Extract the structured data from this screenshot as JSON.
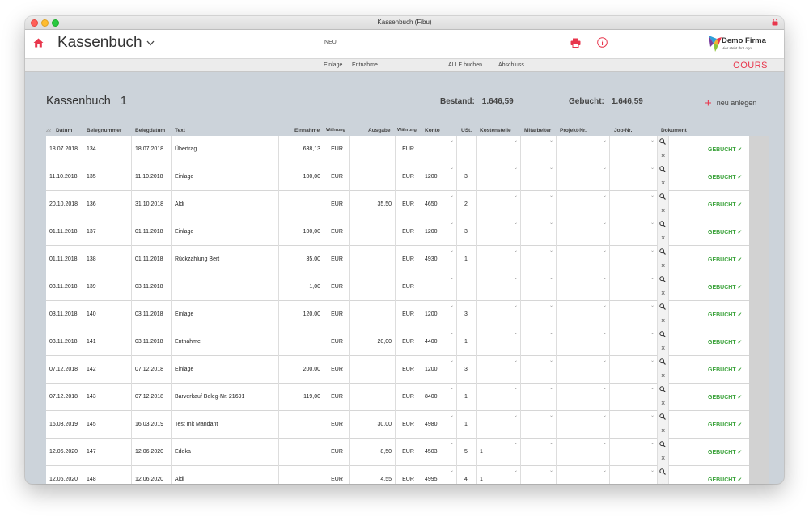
{
  "window": {
    "title": "Kassenbuch (Fibu)"
  },
  "header": {
    "app_title": "Kassenbuch",
    "new_label": "NEU",
    "logo_title": "Demo Firma",
    "logo_subtitle": "Hier steht Ihr Logo"
  },
  "toolbar": {
    "items": [
      "Einlage",
      "Entnahme",
      "ALLE buchen",
      "Abschluss"
    ],
    "brand": "OOURS"
  },
  "summary": {
    "title": "Kassenbuch",
    "number": "1",
    "bestand_label": "Bestand:",
    "bestand_value": "1.646,59",
    "gebucht_label": "Gebucht:",
    "gebucht_value": "1.646,59",
    "new_button": "neu anlegen"
  },
  "table": {
    "count": "22",
    "columns": [
      "Datum",
      "Belegnummer",
      "Belegdatum",
      "Text",
      "Einnahme",
      "Währung",
      "Ausgabe",
      "Währung",
      "Konto",
      "USt.",
      "Kostenstelle",
      "Mitarbeiter",
      "Projekt-Nr.",
      "Job-Nr.",
      "Dokument"
    ],
    "status_label": "GEBUCHT ✓",
    "rows": [
      {
        "datum": "18.07.2018",
        "beleg": "134",
        "belegdatum": "18.07.2018",
        "text": "Übertrag",
        "einnahme": "638,13",
        "w1": "EUR",
        "ausgabe": "",
        "w2": "EUR",
        "konto": "",
        "ust": "",
        "kst": ""
      },
      {
        "datum": "11.10.2018",
        "beleg": "135",
        "belegdatum": "11.10.2018",
        "text": "Einlage",
        "einnahme": "100,00",
        "w1": "EUR",
        "ausgabe": "",
        "w2": "EUR",
        "konto": "1200",
        "ust": "3",
        "kst": ""
      },
      {
        "datum": "20.10.2018",
        "beleg": "136",
        "belegdatum": "31.10.2018",
        "text": "Aldi",
        "einnahme": "",
        "w1": "EUR",
        "ausgabe": "35,50",
        "w2": "EUR",
        "konto": "4650",
        "ust": "2",
        "kst": ""
      },
      {
        "datum": "01.11.2018",
        "beleg": "137",
        "belegdatum": "01.11.2018",
        "text": "Einlage",
        "einnahme": "100,00",
        "w1": "EUR",
        "ausgabe": "",
        "w2": "EUR",
        "konto": "1200",
        "ust": "3",
        "kst": ""
      },
      {
        "datum": "01.11.2018",
        "beleg": "138",
        "belegdatum": "01.11.2018",
        "text": "Rückzahlung Bert",
        "einnahme": "35,00",
        "w1": "EUR",
        "ausgabe": "",
        "w2": "EUR",
        "konto": "4930",
        "ust": "1",
        "kst": ""
      },
      {
        "datum": "03.11.2018",
        "beleg": "139",
        "belegdatum": "03.11.2018",
        "text": "",
        "einnahme": "1,00",
        "w1": "EUR",
        "ausgabe": "",
        "w2": "EUR",
        "konto": "",
        "ust": "",
        "kst": ""
      },
      {
        "datum": "03.11.2018",
        "beleg": "140",
        "belegdatum": "03.11.2018",
        "text": "Einlage",
        "einnahme": "120,00",
        "w1": "EUR",
        "ausgabe": "",
        "w2": "EUR",
        "konto": "1200",
        "ust": "3",
        "kst": ""
      },
      {
        "datum": "03.11.2018",
        "beleg": "141",
        "belegdatum": "03.11.2018",
        "text": "Entnahme",
        "einnahme": "",
        "w1": "EUR",
        "ausgabe": "20,00",
        "w2": "EUR",
        "konto": "4400",
        "ust": "1",
        "kst": ""
      },
      {
        "datum": "07.12.2018",
        "beleg": "142",
        "belegdatum": "07.12.2018",
        "text": "Einlage",
        "einnahme": "200,00",
        "w1": "EUR",
        "ausgabe": "",
        "w2": "EUR",
        "konto": "1200",
        "ust": "3",
        "kst": ""
      },
      {
        "datum": "07.12.2018",
        "beleg": "143",
        "belegdatum": "07.12.2018",
        "text": "Barverkauf Beleg-Nr. 21691",
        "einnahme": "119,00",
        "w1": "EUR",
        "ausgabe": "",
        "w2": "EUR",
        "konto": "8400",
        "ust": "1",
        "kst": ""
      },
      {
        "datum": "16.03.2019",
        "beleg": "145",
        "belegdatum": "16.03.2019",
        "text": "Test mit Mandant",
        "einnahme": "",
        "w1": "EUR",
        "ausgabe": "30,00",
        "w2": "EUR",
        "konto": "4980",
        "ust": "1",
        "kst": ""
      },
      {
        "datum": "12.06.2020",
        "beleg": "147",
        "belegdatum": "12.06.2020",
        "text": "Edeka",
        "einnahme": "",
        "w1": "EUR",
        "ausgabe": "8,50",
        "w2": "EUR",
        "konto": "4503",
        "ust": "5",
        "kst": "1"
      },
      {
        "datum": "12.06.2020",
        "beleg": "148",
        "belegdatum": "12.06.2020",
        "text": "Aldi",
        "einnahme": "",
        "w1": "EUR",
        "ausgabe": "4,55",
        "w2": "EUR",
        "konto": "4995",
        "ust": "4",
        "kst": "1"
      }
    ]
  },
  "colors": {
    "accent": "#e8364c",
    "booked": "#3aa23a",
    "background": "#ccd3da"
  }
}
